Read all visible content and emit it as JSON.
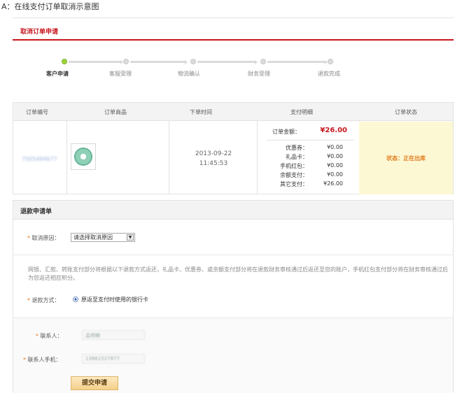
{
  "caption": "A：在线支付订单取消示意图",
  "header": {
    "title": "取消订单申请"
  },
  "steps": [
    {
      "label": "客户申请",
      "active": true
    },
    {
      "label": "客服受理",
      "active": false
    },
    {
      "label": "物流确认",
      "active": false
    },
    {
      "label": "财务受理",
      "active": false
    },
    {
      "label": "退款完成",
      "active": false
    }
  ],
  "order_table": {
    "headers": [
      "订单编号",
      "订单商品",
      "下单时间",
      "支付明细",
      "订单状态"
    ],
    "order_no": "7505484677",
    "order_date": "2013-09-22",
    "order_time": "11:45:53",
    "total_label": "订单金额：",
    "total_value": "¥26.00",
    "payment_rows": [
      {
        "label": "优惠券：",
        "value": "¥0.00"
      },
      {
        "label": "礼品卡：",
        "value": "¥0.00"
      },
      {
        "label": "手机红包：",
        "value": "¥0.00"
      },
      {
        "label": "余额支付：",
        "value": "¥0.00"
      },
      {
        "label": "其它支付：",
        "value": "¥26.00"
      }
    ],
    "status": "状态：正在出库"
  },
  "refund_form": {
    "title": "退款申请单",
    "reason_label": "取消原因：",
    "reason_selected": "请选择取消原因",
    "notice": "网银、汇款、转账支付部分将根据以下退款方式返还，礼品卡、优惠券、或余额支付部分将在退款财务审核通过后返还至您的账户，手机红包支付部分将在财务审核通过后为您返还相应积分。",
    "refund_method_label": "退款方式：",
    "refund_method_option": "原返至支付时使用的银行卡",
    "contact_label": "联系人：",
    "contact_value": "孟明楠",
    "phone_label": "联系人手机：",
    "phone_value": "13861527877",
    "submit_label": "提交申请"
  }
}
